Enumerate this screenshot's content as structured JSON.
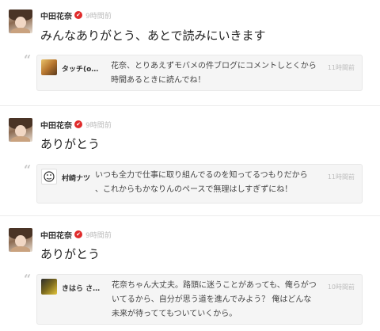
{
  "posts": [
    {
      "author": "中田花奈",
      "time": "9時間前",
      "text": "みんなありがとう、あとで読みにいきます",
      "reply": {
        "name": "タッチ(o…",
        "line1": "花奈、とりあえずモバメの件ブログにコメントしとくから",
        "line2": "時間あるときに読んでね！",
        "time": "11時間前"
      }
    },
    {
      "author": "中田花奈",
      "time": "9時間前",
      "text": "ありがとう",
      "reply": {
        "name": "村崎ナツ",
        "line1": "いつも全力で仕事に取り組んでるのを知ってるつもりだから",
        "line2": "、これからもかなりんのペースで無理はしすぎずにね！",
        "time": "11時間前"
      }
    },
    {
      "author": "中田花奈",
      "time": "9時間前",
      "text": "ありがとう",
      "reply": {
        "name": "きはら さ…",
        "line1": "花奈ちゃん大丈夫。路頭に迷うことがあっても、俺らがつ",
        "line2": "いてるから、自分が思う道を進んでみよう？ 俺はどんな",
        "line3": "未来が待っててもついていくから。",
        "time": "10時間前"
      }
    }
  ],
  "verified_symbol": "✔",
  "quote_symbol": "“",
  "colors": {
    "verified": "#e02b2b",
    "timestamp": "#bcbcbc",
    "reply_bg": "#f5f5f5"
  }
}
